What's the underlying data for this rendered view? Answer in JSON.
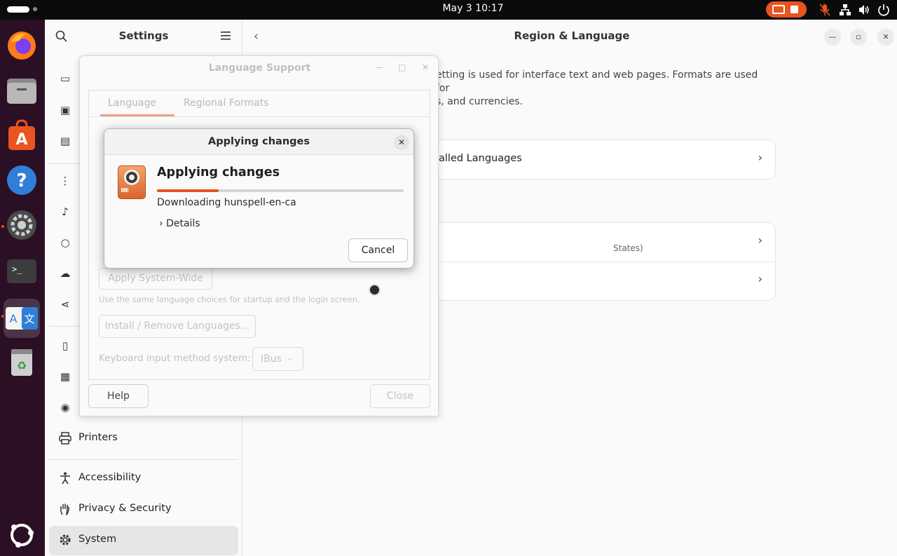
{
  "topbar": {
    "clock": "May 3  10:17",
    "tray_icons": [
      "mic-off-icon",
      "network-icon",
      "volume-icon",
      "power-icon"
    ]
  },
  "dock": {
    "apps": [
      "firefox-icon",
      "files-icon",
      "app-center-icon",
      "help-icon",
      "settings-icon",
      "terminal-icon",
      "language-support-icon",
      "trash-icon",
      "show-apps-icon"
    ]
  },
  "settings": {
    "sidebar_title": "Settings",
    "sidebar_items": [
      {
        "label": "Printers",
        "icon": "printer-icon"
      },
      {
        "label": "Accessibility",
        "icon": "accessibility-icon"
      },
      {
        "label": "Privacy & Security",
        "icon": "hand-icon"
      },
      {
        "label": "System",
        "icon": "gear-icon"
      }
    ],
    "page_title": "Region & Language",
    "description_line1": "etting is used for interface text and web pages. Formats are used for",
    "description_line2": "s, and currencies.",
    "installed_languages_label": "alled Languages",
    "formats_sub": "States)"
  },
  "language_support": {
    "title": "Language Support",
    "tabs": [
      "Language",
      "Regional Formats"
    ],
    "apply_system_wide": "Apply System-Wide",
    "hint": "Use the same language choices for startup and the login screen.",
    "install_remove": "Install / Remove Languages...",
    "keyboard_label": "Keyboard input method system:",
    "keyboard_value": "IBus",
    "help": "Help",
    "close": "Close"
  },
  "apply_dialog": {
    "title": "Applying changes",
    "heading": "Applying changes",
    "status": "Downloading hunspell-en-ca",
    "details": "Details",
    "cancel": "Cancel",
    "progress": 0.25
  }
}
